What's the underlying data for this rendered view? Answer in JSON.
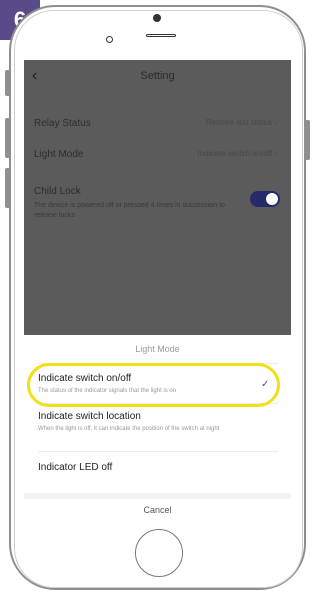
{
  "step": {
    "number": "6"
  },
  "screen": {
    "nav": {
      "back_icon": "‹",
      "title": "Setting"
    },
    "rows": [
      {
        "label": "Relay Status",
        "value": "Restore last status ›"
      },
      {
        "label": "Light Mode",
        "value": "Indicate switch on/off ›"
      }
    ],
    "child_lock": {
      "label": "Child Lock",
      "description": "The device is powered off or pressed 4 times in succession to release locks",
      "enabled": true
    }
  },
  "sheet": {
    "title": "Light Mode",
    "options": [
      {
        "label": "Indicate switch on/off",
        "description": "The status of the indicator signals that the light is on",
        "selected": true
      },
      {
        "label": "Indicate switch location",
        "description": "When the light is off, it can indicate the position of the switch at night"
      },
      {
        "label": "Indicator LED off"
      }
    ],
    "check_icon": "✓",
    "cancel": "Cancel"
  },
  "colors": {
    "badge": "#5b4a8a",
    "highlight": "#f1df18",
    "toggle_on": "#242a6a",
    "check": "#4d4fa8"
  }
}
